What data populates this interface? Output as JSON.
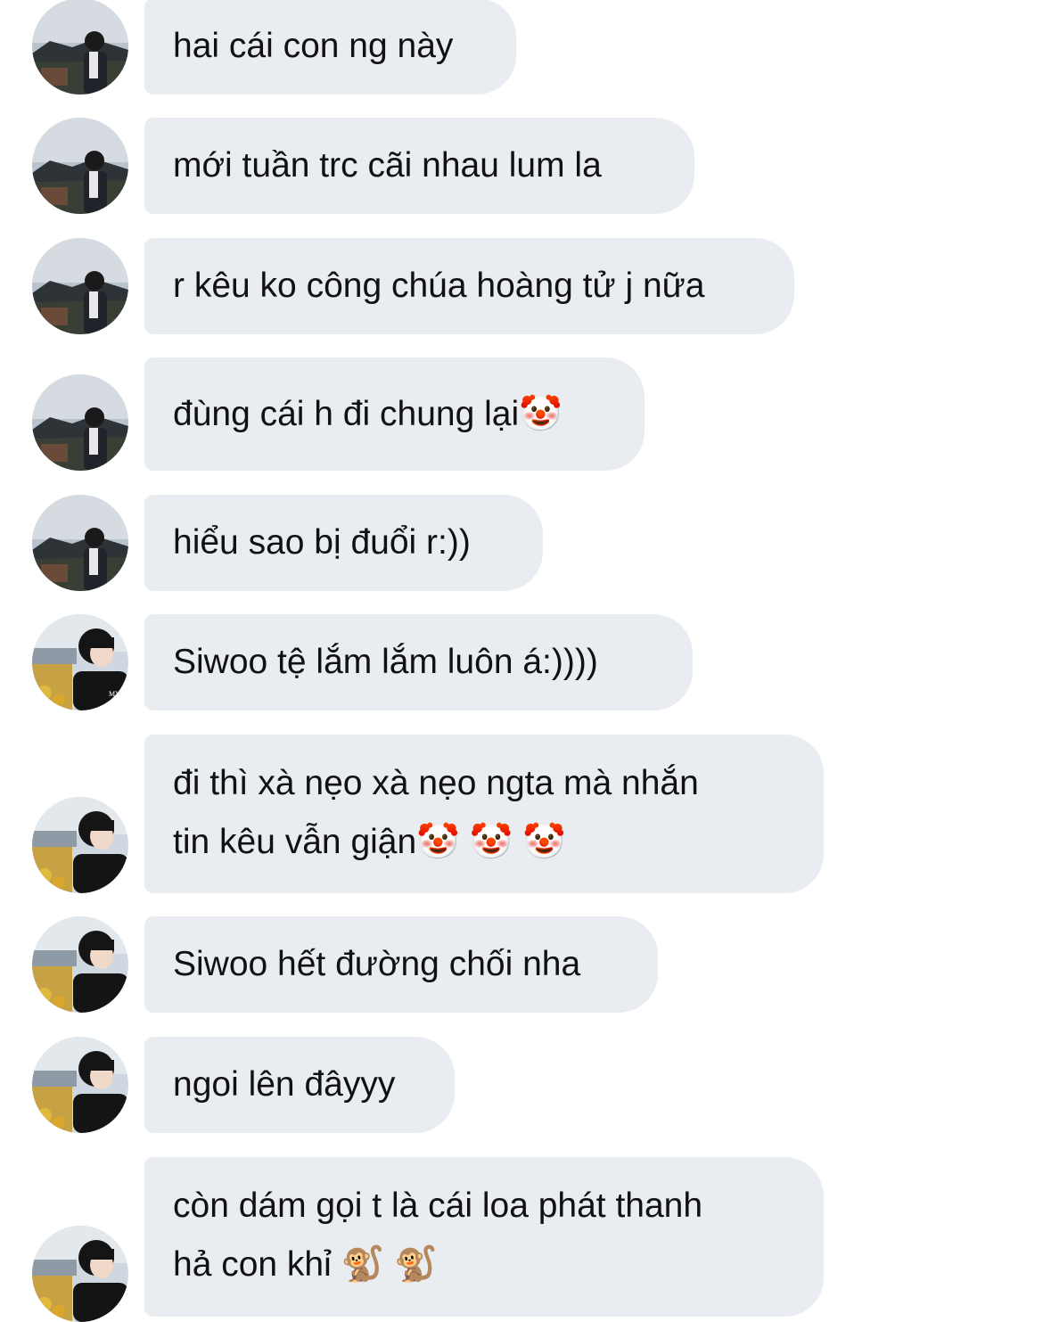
{
  "messages": [
    {
      "sender": "a",
      "text": "hai cái con ng này"
    },
    {
      "sender": "a",
      "text": "mới tuần trc cãi nhau lum la"
    },
    {
      "sender": "a",
      "text": "r kêu ko công chúa hoàng tử j nữa"
    },
    {
      "sender": "a",
      "text": "đùng cái h đi chung lại🤡"
    },
    {
      "sender": "a",
      "text": "hiểu sao bị đuổi r:))"
    },
    {
      "sender": "b",
      "text": "Siwoo tệ lắm lắm luôn á:))))"
    },
    {
      "sender": "b",
      "text": "đi thì xà nẹo xà nẹo ngta mà nhắn\ntin kêu vẫn giận🤡 🤡 🤡"
    },
    {
      "sender": "b",
      "text": "Siwoo hết đường chối nha"
    },
    {
      "sender": "b",
      "text": "ngoi lên đâyyy"
    },
    {
      "sender": "b",
      "text": "còn dám gọi t là cái loa phát thanh\nhả con khỉ 🐒 🐒"
    }
  ],
  "colors": {
    "bubble": "#e9ecf0",
    "text": "#111111"
  },
  "icons": {
    "avatar_a": "avatar-photo-temple",
    "avatar_b": "avatar-photo-city"
  }
}
